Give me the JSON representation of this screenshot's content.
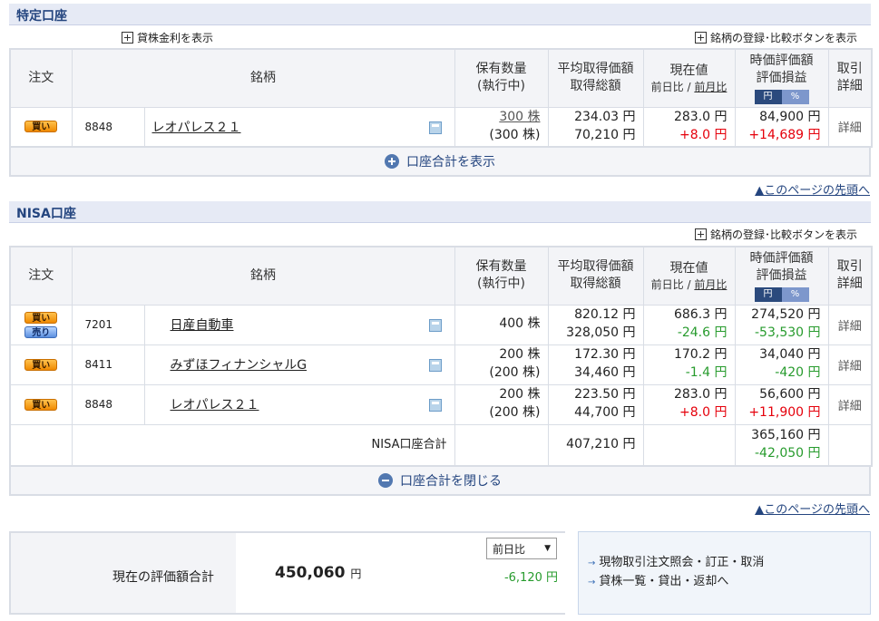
{
  "tokutei": {
    "title": "特定口座",
    "lending_rate_link": "貸株金利を表示",
    "register_link": "銘柄の登録･比較ボタンを表示",
    "headers": {
      "order": "注文",
      "stock": "銘柄",
      "qty_1": "保有数量",
      "qty_2": "(執行中)",
      "avg_1": "平均取得価額",
      "avg_2": "取得総額",
      "price_1": "現在値",
      "price_day": "前日比",
      "price_sep": "/",
      "price_month": "前月比",
      "val_1": "時価評価額",
      "val_2": "評価損益",
      "toggle_yen": "円",
      "toggle_pct": "%",
      "trade_1": "取引",
      "trade_2": "詳細"
    },
    "rows": [
      {
        "buy": "買い",
        "code": "8848",
        "name": "レオパレス２１",
        "qty": "300 株",
        "qty_exec": "(300 株)",
        "avg": "234.03 円",
        "total_cost": "70,210 円",
        "price": "283.0 円",
        "change": "+8.0 円",
        "value": "84,900 円",
        "pnl": "+14,689 円",
        "detail": "詳細"
      }
    ],
    "summary_toggle": "口座合計を表示"
  },
  "page_top": "▲このページの先頭へ",
  "nisa": {
    "title": "NISA口座",
    "register_link": "銘柄の登録･比較ボタンを表示",
    "rows": [
      {
        "buy": "買い",
        "sell": "売り",
        "code": "7201",
        "name": "日産自動車",
        "qty": "400 株",
        "avg": "820.12 円",
        "total_cost": "328,050 円",
        "price": "686.3 円",
        "change": "-24.6 円",
        "value": "274,520 円",
        "pnl": "-53,530 円",
        "detail": "詳細"
      },
      {
        "buy": "買い",
        "code": "8411",
        "name": "みずほフィナンシャルG",
        "qty": "200 株",
        "qty_exec": "(200 株)",
        "avg": "172.30 円",
        "total_cost": "34,460 円",
        "price": "170.2 円",
        "change": "-1.4 円",
        "value": "34,040 円",
        "pnl": "-420 円",
        "detail": "詳細"
      },
      {
        "buy": "買い",
        "code": "8848",
        "name": "レオパレス２１",
        "qty": "200 株",
        "qty_exec": "(200 株)",
        "avg": "223.50 円",
        "total_cost": "44,700 円",
        "price": "283.0 円",
        "change": "+8.0 円",
        "value": "56,600 円",
        "pnl": "+11,900 円",
        "detail": "詳細"
      }
    ],
    "total": {
      "label": "NISA口座合計",
      "total_cost": "407,210 円",
      "value": "365,160 円",
      "pnl": "-42,050 円"
    },
    "summary_toggle": "口座合計を閉じる"
  },
  "grand_total": {
    "label": "現在の評価額合計",
    "value": "450,060",
    "unit": "円",
    "select_value": "前日比",
    "change": "-6,120 円"
  },
  "links": {
    "item1": "現物取引注文照会・訂正・取消",
    "item2": "貸株一覧・貸出・返却へ"
  },
  "colors": {
    "positive": "#e5000b",
    "negative": "#279b2d",
    "accent": "#24457f"
  }
}
